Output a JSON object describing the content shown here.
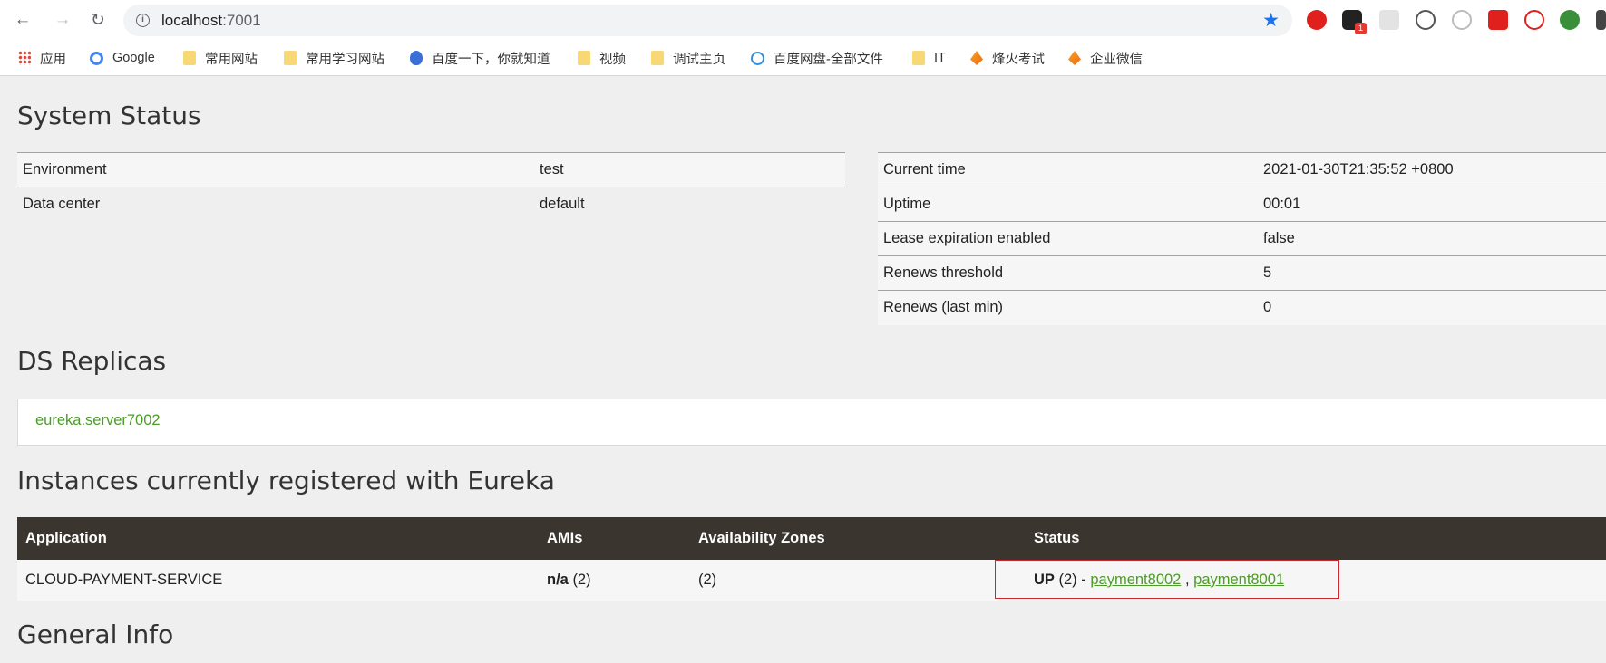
{
  "browser": {
    "url_host": "localhost",
    "url_port": ":7001",
    "bookmarks": [
      {
        "label": "应用",
        "icon": "apps-grid-icon"
      },
      {
        "label": "Google",
        "icon": "google-icon"
      },
      {
        "label": "常用网站",
        "icon": "folder-icon"
      },
      {
        "label": "常用学习网站",
        "icon": "folder-icon"
      },
      {
        "label": "百度一下，你就知道",
        "icon": "baidu-icon"
      },
      {
        "label": "视频",
        "icon": "folder-icon"
      },
      {
        "label": "调试主页",
        "icon": "folder-icon"
      },
      {
        "label": "百度网盘-全部文件",
        "icon": "baidu-netdisk-icon"
      },
      {
        "label": "IT",
        "icon": "folder-icon"
      },
      {
        "label": "烽火考试",
        "icon": "fire-icon"
      },
      {
        "label": "企业微信",
        "icon": "fire-icon"
      }
    ],
    "extension_badge": "1"
  },
  "system_status": {
    "heading": "System Status",
    "left": [
      {
        "label": "Environment",
        "value": "test"
      },
      {
        "label": "Data center",
        "value": "default"
      }
    ],
    "right": [
      {
        "label": "Current time",
        "value": "2021-01-30T21:35:52 +0800"
      },
      {
        "label": "Uptime",
        "value": "00:01"
      },
      {
        "label": "Lease expiration enabled",
        "value": "false"
      },
      {
        "label": "Renews threshold",
        "value": "5"
      },
      {
        "label": "Renews (last min)",
        "value": "0"
      }
    ]
  },
  "replicas": {
    "heading": "DS Replicas",
    "link": "eureka.server7002"
  },
  "instances": {
    "heading": "Instances currently registered with Eureka",
    "columns": [
      "Application",
      "AMIs",
      "Availability Zones",
      "Status"
    ],
    "rows": [
      {
        "application": "CLOUD-PAYMENT-SERVICE",
        "ami_value": "n/a",
        "ami_count": "(2)",
        "zones": "(2)",
        "status_word": "UP",
        "status_count": "(2) -",
        "instance_1": "payment8002",
        "separator": ",",
        "instance_2": "payment8001"
      }
    ]
  },
  "general_info": {
    "heading": "General Info"
  },
  "colors": {
    "link_green": "#4d9b2a",
    "header_bar": "#3b352f",
    "highlight_red": "#d0252a"
  }
}
